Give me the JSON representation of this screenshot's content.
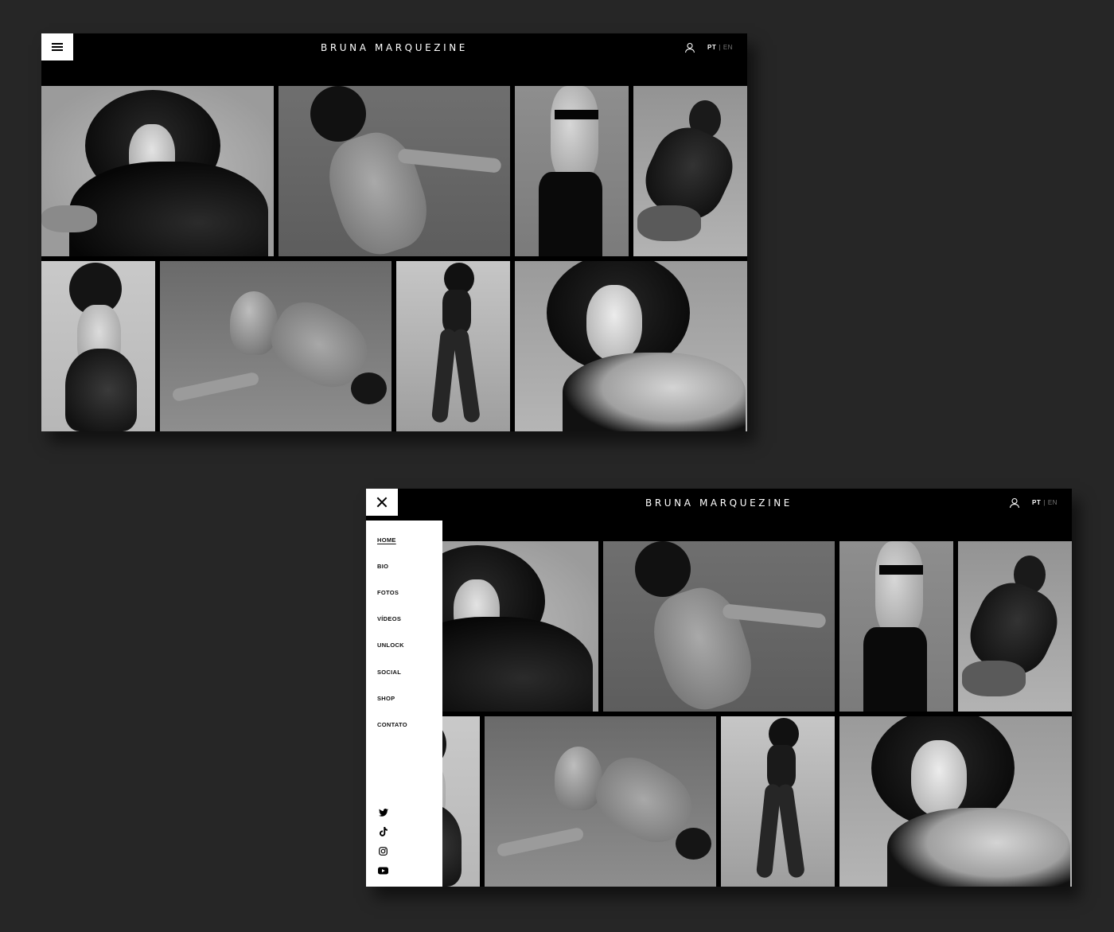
{
  "brand": "BRUNA MARQUEZINE",
  "lang": {
    "pt": "PT",
    "separator": "|",
    "en": "EN"
  },
  "menu": {
    "items": [
      {
        "label": "HOME",
        "active": true
      },
      {
        "label": "BIO"
      },
      {
        "label": "FOTOS"
      },
      {
        "label": "VÍDEOS"
      },
      {
        "label": "UNLOCK"
      },
      {
        "label": "SOCIAL"
      },
      {
        "label": "SHOP"
      },
      {
        "label": "CONTATO"
      }
    ],
    "social": [
      "twitter-icon",
      "tiktok-icon",
      "instagram-icon",
      "youtube-icon"
    ]
  },
  "gallery": [
    {
      "name": "portrait-curly-hair-ruffles"
    },
    {
      "name": "leaning-sweater-arm-extended"
    },
    {
      "name": "back-view-bandeau"
    },
    {
      "name": "kneeling-cardigan"
    },
    {
      "name": "tights-gloves-pose"
    },
    {
      "name": "bowing-sweater-floor"
    },
    {
      "name": "corset-standing-full"
    },
    {
      "name": "closeup-chain-necklace"
    }
  ],
  "colors": {
    "background": "#262626",
    "header": "#000000",
    "menu": "#ffffff"
  }
}
